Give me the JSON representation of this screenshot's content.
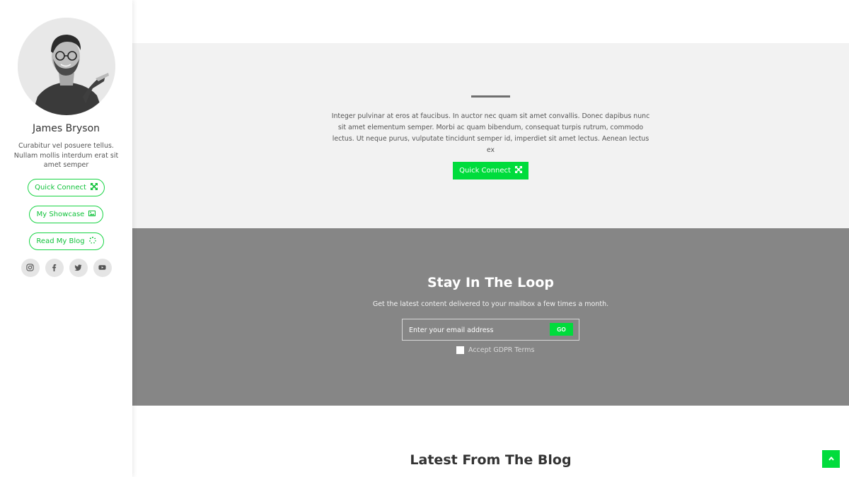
{
  "profile": {
    "name": "James Bryson",
    "bio": "Curabitur vel posuere tellus. Nullam mollis interdum erat sit amet semper"
  },
  "sidebar": {
    "buttons": [
      {
        "label": "Quick Connect",
        "icon": "expand-icon"
      },
      {
        "label": "My Showcase",
        "icon": "image-icon"
      },
      {
        "label": "Read My Blog",
        "icon": "spinner-icon"
      }
    ],
    "socials": [
      "instagram-icon",
      "facebook-icon",
      "twitter-icon",
      "youtube-icon"
    ]
  },
  "intro": {
    "text": "Integer pulvinar at eros at faucibus. In auctor nec quam sit amet convallis. Donec dapibus nunc sit amet elementum semper. Morbi ac quam bibendum, consequat turpis rutrum, commodo lectus. Ut neque purus, vulputate tincidunt semper id, imperdiet sit amet lectus. Aenean lectus ex",
    "cta_label": "Quick Connect"
  },
  "newsletter": {
    "title": "Stay In The Loop",
    "subtitle": "Get the latest content delivered to your mailbox a few times a month.",
    "email_placeholder": "Enter your email address",
    "go_label": "GO",
    "gdpr_label": "Accept GDPR Terms"
  },
  "blog": {
    "title": "Latest From The Blog"
  },
  "colors": {
    "accent": "#00dc3c",
    "intro_bg": "#f2f2f2",
    "newsletter_bg": "#868686"
  }
}
